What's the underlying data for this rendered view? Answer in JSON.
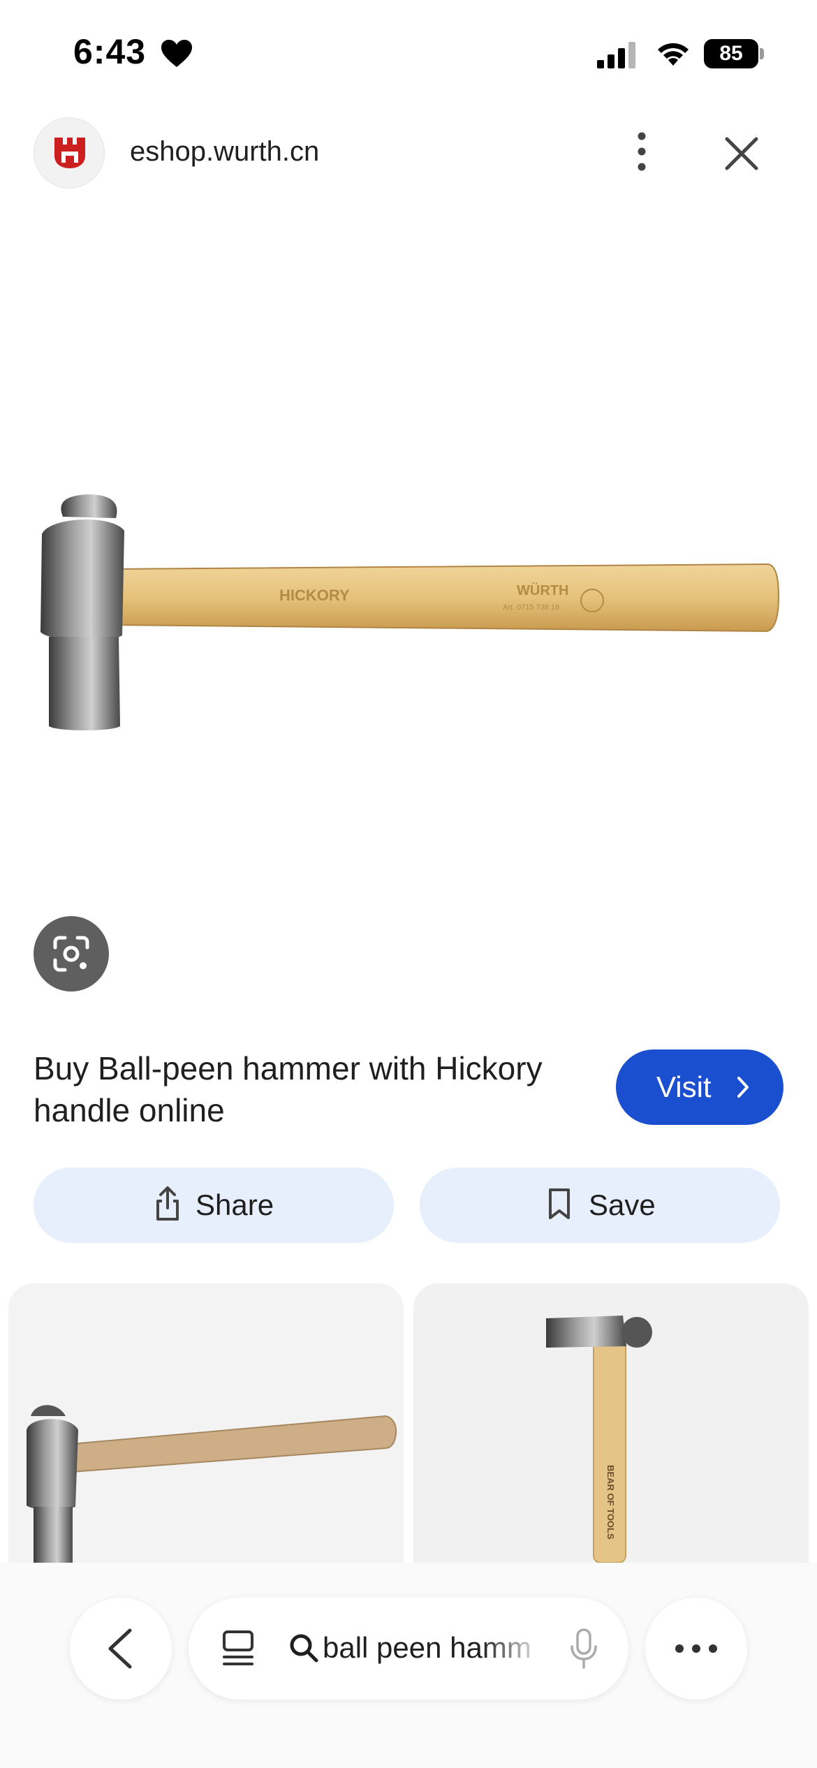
{
  "status_bar": {
    "time": "6:43",
    "battery": "85"
  },
  "header": {
    "domain": "eshop.wurth.cn",
    "brand_color": "#cc1f1f"
  },
  "main_image": {
    "handle_text": "HICKORY",
    "brand_text": "WÜRTH",
    "article_text": "Art. 0715 738 16"
  },
  "result": {
    "title": "Buy Ball-peen hammer with Hickory handle online",
    "visit_label": "Visit"
  },
  "actions": {
    "share_label": "Share",
    "save_label": "Save"
  },
  "grid": {
    "card2_handle_text": "BEAR OF TOOLS"
  },
  "bottom_bar": {
    "search_query": "ball peen hammer"
  },
  "colors": {
    "visit_button": "#1a4fd0",
    "action_button_bg": "#e8effc",
    "lens_button": "#5f5f5f"
  }
}
